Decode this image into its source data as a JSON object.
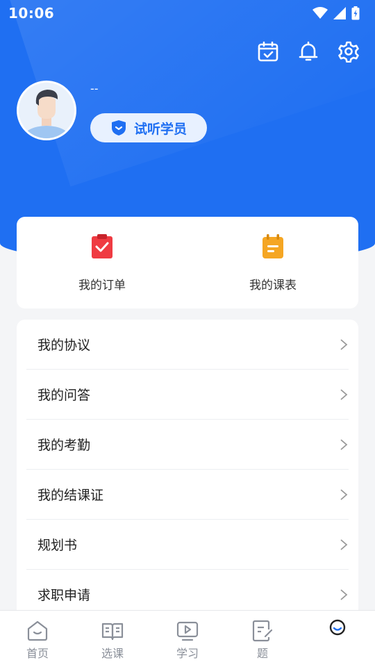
{
  "status_bar": {
    "time": "10:06"
  },
  "header": {
    "icons": [
      "calendar-check-icon",
      "bell-icon",
      "gear-icon"
    ],
    "username": "--",
    "badge_label": "试听学员"
  },
  "quick_actions": [
    {
      "label": "我的订单",
      "icon": "order-clipboard-icon",
      "color": "#ef3b42"
    },
    {
      "label": "我的课表",
      "icon": "schedule-notepad-icon",
      "color": "#f5a623"
    }
  ],
  "menu": [
    {
      "label": "我的协议"
    },
    {
      "label": "我的问答"
    },
    {
      "label": "我的考勤"
    },
    {
      "label": "我的结课证"
    },
    {
      "label": "规划书"
    },
    {
      "label": "求职申请"
    }
  ],
  "tabbar": [
    {
      "label": "首页",
      "icon": "home-icon"
    },
    {
      "label": "选课",
      "icon": "book-icon"
    },
    {
      "label": "学习",
      "icon": "play-screen-icon"
    },
    {
      "label": "题",
      "icon": "exam-icon"
    },
    {
      "label": "",
      "icon": "profile-face-icon",
      "active": true
    }
  ],
  "colors": {
    "primary": "#1f6ff2",
    "badge_bg": "#e8f1ff",
    "tab_inactive": "#8a8f99"
  }
}
